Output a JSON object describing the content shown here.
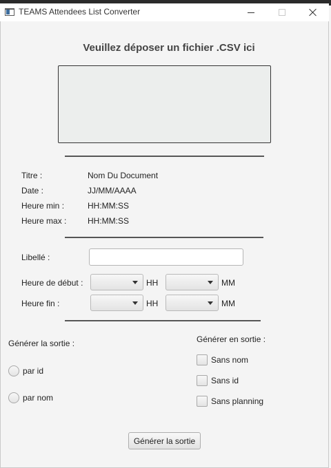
{
  "window": {
    "title": "TEAMS Attendees List Converter"
  },
  "header": {
    "title": "Veuillez déposer un fichier .CSV ici"
  },
  "info": [
    {
      "label": "Titre :",
      "value": "Nom Du Document"
    },
    {
      "label": "Date :",
      "value": "JJ/MM/AAAA"
    },
    {
      "label": "Heure min :",
      "value": "HH:MM:SS"
    },
    {
      "label": "Heure max :",
      "value": "HH:MM:SS"
    }
  ],
  "form": {
    "libelle_label": "Libellé :",
    "libelle_value": "",
    "start_label": "Heure de début :",
    "end_label": "Heure fin :",
    "hour_unit": "HH",
    "minute_unit": "MM"
  },
  "output_mode": {
    "label": "Générer la sortie :",
    "options": [
      "par id",
      "par nom"
    ]
  },
  "output_extras": {
    "label": "Générer en sortie :",
    "options": [
      "Sans nom",
      "Sans id",
      "Sans planning"
    ]
  },
  "generate_button": "Générer la sortie"
}
